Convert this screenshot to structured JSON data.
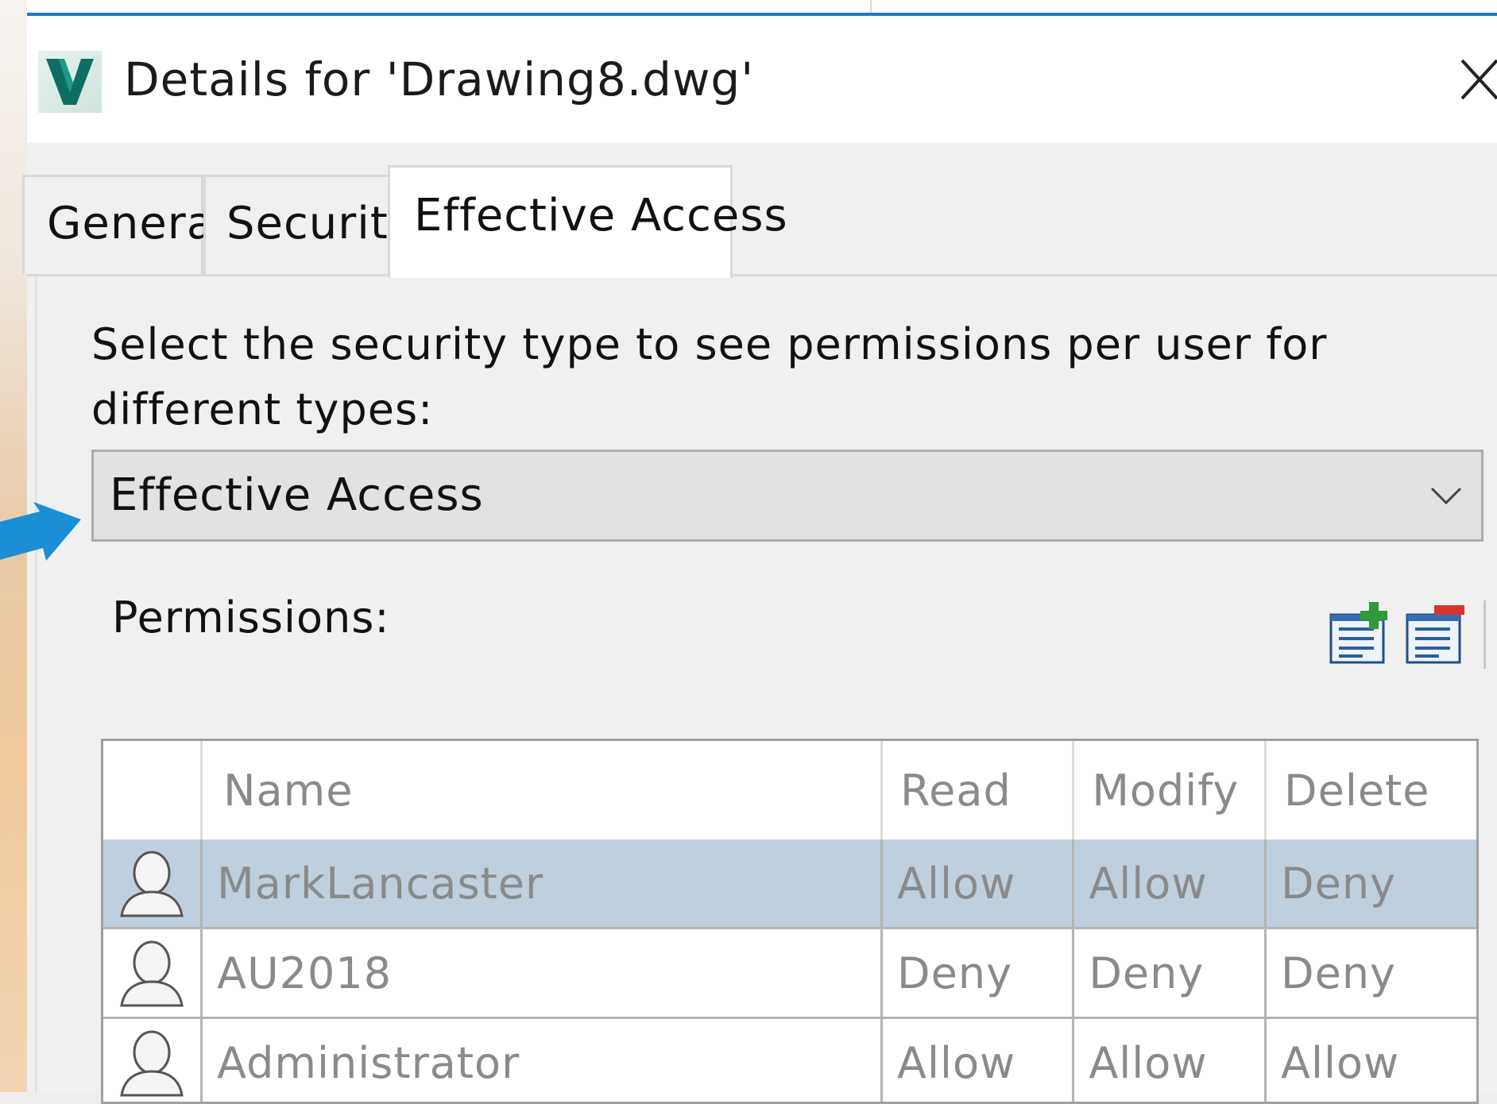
{
  "window": {
    "title": "Details for 'Drawing8.dwg'",
    "accent_color": "#1979c9",
    "app_icon": "vault-app-icon",
    "close_icon": "close-icon"
  },
  "tabs": [
    {
      "label": "General",
      "active": false
    },
    {
      "label": "Security",
      "active": false
    },
    {
      "label": "Effective Access",
      "active": true
    }
  ],
  "effective_access": {
    "instruction": "Select the security type to see permissions per user for different types:",
    "security_type": {
      "selected": "Effective Access",
      "icon": "chevron-down-icon"
    },
    "permissions_label": "Permissions:",
    "toolbar": [
      {
        "name": "add-permission-button",
        "icon": "add-entry-icon"
      },
      {
        "name": "remove-permission-button",
        "icon": "remove-entry-icon"
      }
    ],
    "table": {
      "columns": [
        "",
        "Name",
        "Read",
        "Modify",
        "Delete"
      ],
      "rows": [
        {
          "icon": "user-icon",
          "name": "MarkLancaster",
          "read": "Allow",
          "modify": "Allow",
          "delete": "Deny",
          "selected": true
        },
        {
          "icon": "user-icon",
          "name": "AU2018",
          "read": "Deny",
          "modify": "Deny",
          "delete": "Deny",
          "selected": false
        },
        {
          "icon": "user-icon",
          "name": "Administrator",
          "read": "Allow",
          "modify": "Allow",
          "delete": "Allow",
          "selected": false
        }
      ],
      "selected_row_color": "#bfcfdd"
    }
  },
  "annotation": {
    "icon": "pointer-arrow-icon",
    "color": "#1a8fd6"
  }
}
